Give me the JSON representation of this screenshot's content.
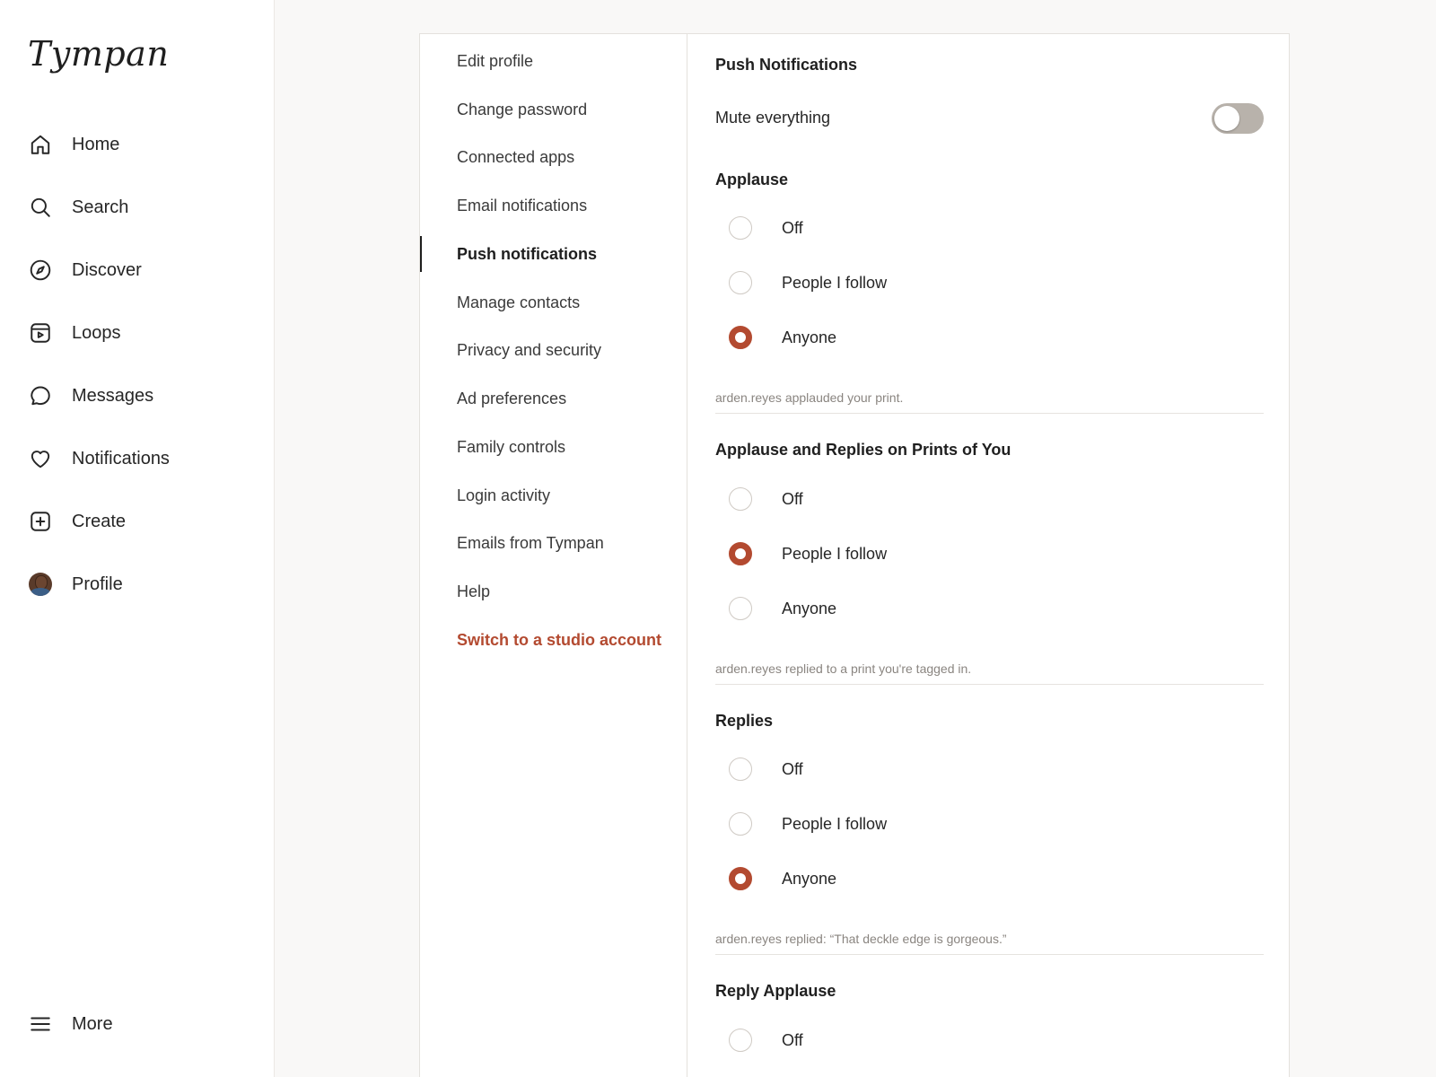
{
  "app": {
    "logo": "Tympan"
  },
  "nav": {
    "items": [
      {
        "label": "Home",
        "icon": "home-icon"
      },
      {
        "label": "Search",
        "icon": "search-icon"
      },
      {
        "label": "Discover",
        "icon": "compass-icon"
      },
      {
        "label": "Loops",
        "icon": "loops-icon"
      },
      {
        "label": "Messages",
        "icon": "message-icon"
      },
      {
        "label": "Notifications",
        "icon": "heart-icon"
      },
      {
        "label": "Create",
        "icon": "plus-square-icon"
      },
      {
        "label": "Profile",
        "icon": "avatar"
      }
    ],
    "more": {
      "label": "More",
      "icon": "menu-icon"
    }
  },
  "settings_menu": {
    "items": [
      "Edit profile",
      "Change password",
      "Connected apps",
      "Email notifications",
      "Push notifications",
      "Manage contacts",
      "Privacy and security",
      "Ad preferences",
      "Family controls",
      "Login activity",
      "Emails from Tympan",
      "Help"
    ],
    "active": "Push notifications",
    "studio_link": "Switch to a studio account"
  },
  "push": {
    "title": "Push Notifications",
    "mute_label": "Mute everything",
    "mute_on": false,
    "sections": [
      {
        "title": "Applause",
        "options": [
          "Off",
          "People I follow",
          "Anyone"
        ],
        "selected": 2,
        "example": "arden.reyes applauded your print."
      },
      {
        "title": "Applause and Replies on Prints of You",
        "options": [
          "Off",
          "People I follow",
          "Anyone"
        ],
        "selected": 1,
        "example": "arden.reyes replied to a print you're tagged in."
      },
      {
        "title": "Replies",
        "options": [
          "Off",
          "People I follow",
          "Anyone"
        ],
        "selected": 2,
        "example": "arden.reyes replied: “That deckle edge is gorgeous.”"
      },
      {
        "title": "Reply Applause",
        "options": [
          "Off"
        ],
        "selected": -1
      }
    ]
  },
  "colors": {
    "accent": "#b34a30",
    "toggle_off": "#b8b2ab",
    "background": "#f9f8f7"
  }
}
